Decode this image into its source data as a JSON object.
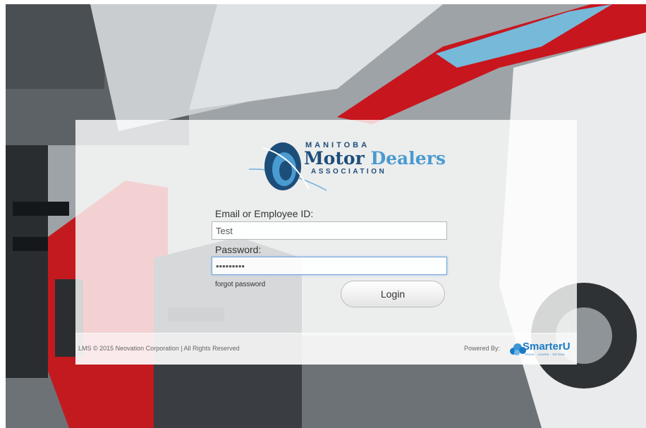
{
  "brand": {
    "line1": "MANITOBA",
    "line2a": "Motor",
    "line2b": "Dealers",
    "line3": "ASSOCIATION",
    "color_primary": "#1d4e7a",
    "color_accent": "#4a9bd0"
  },
  "form": {
    "email_label": "Email or Employee ID:",
    "email_value": "Test",
    "password_label": "Password:",
    "password_value": "*********",
    "forgot_label": "forgot password",
    "login_label": "Login"
  },
  "footer": {
    "copyright": "LMS © 2015 Neovation Corporation  |  All Rights Reserved",
    "powered_by": "Powered By:",
    "provider_name": "SmarterU",
    "provider_tagline": "TRAIN · LEARN · RETAIN",
    "provider_color": "#1a7ac4"
  },
  "icons": {
    "brand_logo": "mmda-logo-icon",
    "provider_logo": "smarteru-cloud-icon"
  }
}
